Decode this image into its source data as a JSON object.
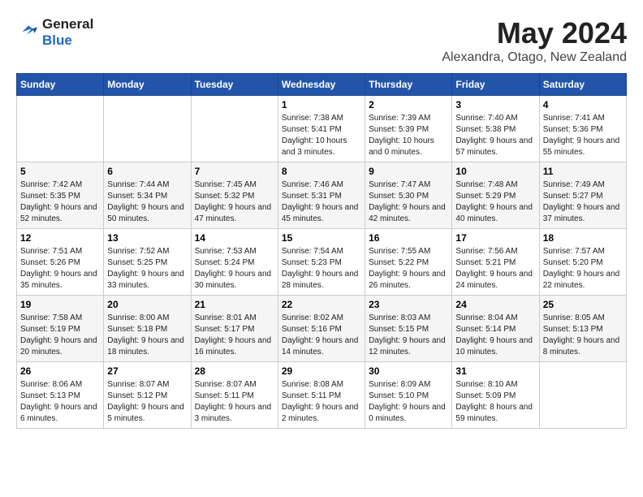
{
  "logo": {
    "line1": "General",
    "line2": "Blue"
  },
  "title": "May 2024",
  "location": "Alexandra, Otago, New Zealand",
  "weekdays": [
    "Sunday",
    "Monday",
    "Tuesday",
    "Wednesday",
    "Thursday",
    "Friday",
    "Saturday"
  ],
  "weeks": [
    [
      {
        "day": "",
        "sunrise": "",
        "sunset": "",
        "daylight": ""
      },
      {
        "day": "",
        "sunrise": "",
        "sunset": "",
        "daylight": ""
      },
      {
        "day": "",
        "sunrise": "",
        "sunset": "",
        "daylight": ""
      },
      {
        "day": "1",
        "sunrise": "Sunrise: 7:38 AM",
        "sunset": "Sunset: 5:41 PM",
        "daylight": "Daylight: 10 hours and 3 minutes."
      },
      {
        "day": "2",
        "sunrise": "Sunrise: 7:39 AM",
        "sunset": "Sunset: 5:39 PM",
        "daylight": "Daylight: 10 hours and 0 minutes."
      },
      {
        "day": "3",
        "sunrise": "Sunrise: 7:40 AM",
        "sunset": "Sunset: 5:38 PM",
        "daylight": "Daylight: 9 hours and 57 minutes."
      },
      {
        "day": "4",
        "sunrise": "Sunrise: 7:41 AM",
        "sunset": "Sunset: 5:36 PM",
        "daylight": "Daylight: 9 hours and 55 minutes."
      }
    ],
    [
      {
        "day": "5",
        "sunrise": "Sunrise: 7:42 AM",
        "sunset": "Sunset: 5:35 PM",
        "daylight": "Daylight: 9 hours and 52 minutes."
      },
      {
        "day": "6",
        "sunrise": "Sunrise: 7:44 AM",
        "sunset": "Sunset: 5:34 PM",
        "daylight": "Daylight: 9 hours and 50 minutes."
      },
      {
        "day": "7",
        "sunrise": "Sunrise: 7:45 AM",
        "sunset": "Sunset: 5:32 PM",
        "daylight": "Daylight: 9 hours and 47 minutes."
      },
      {
        "day": "8",
        "sunrise": "Sunrise: 7:46 AM",
        "sunset": "Sunset: 5:31 PM",
        "daylight": "Daylight: 9 hours and 45 minutes."
      },
      {
        "day": "9",
        "sunrise": "Sunrise: 7:47 AM",
        "sunset": "Sunset: 5:30 PM",
        "daylight": "Daylight: 9 hours and 42 minutes."
      },
      {
        "day": "10",
        "sunrise": "Sunrise: 7:48 AM",
        "sunset": "Sunset: 5:29 PM",
        "daylight": "Daylight: 9 hours and 40 minutes."
      },
      {
        "day": "11",
        "sunrise": "Sunrise: 7:49 AM",
        "sunset": "Sunset: 5:27 PM",
        "daylight": "Daylight: 9 hours and 37 minutes."
      }
    ],
    [
      {
        "day": "12",
        "sunrise": "Sunrise: 7:51 AM",
        "sunset": "Sunset: 5:26 PM",
        "daylight": "Daylight: 9 hours and 35 minutes."
      },
      {
        "day": "13",
        "sunrise": "Sunrise: 7:52 AM",
        "sunset": "Sunset: 5:25 PM",
        "daylight": "Daylight: 9 hours and 33 minutes."
      },
      {
        "day": "14",
        "sunrise": "Sunrise: 7:53 AM",
        "sunset": "Sunset: 5:24 PM",
        "daylight": "Daylight: 9 hours and 30 minutes."
      },
      {
        "day": "15",
        "sunrise": "Sunrise: 7:54 AM",
        "sunset": "Sunset: 5:23 PM",
        "daylight": "Daylight: 9 hours and 28 minutes."
      },
      {
        "day": "16",
        "sunrise": "Sunrise: 7:55 AM",
        "sunset": "Sunset: 5:22 PM",
        "daylight": "Daylight: 9 hours and 26 minutes."
      },
      {
        "day": "17",
        "sunrise": "Sunrise: 7:56 AM",
        "sunset": "Sunset: 5:21 PM",
        "daylight": "Daylight: 9 hours and 24 minutes."
      },
      {
        "day": "18",
        "sunrise": "Sunrise: 7:57 AM",
        "sunset": "Sunset: 5:20 PM",
        "daylight": "Daylight: 9 hours and 22 minutes."
      }
    ],
    [
      {
        "day": "19",
        "sunrise": "Sunrise: 7:58 AM",
        "sunset": "Sunset: 5:19 PM",
        "daylight": "Daylight: 9 hours and 20 minutes."
      },
      {
        "day": "20",
        "sunrise": "Sunrise: 8:00 AM",
        "sunset": "Sunset: 5:18 PM",
        "daylight": "Daylight: 9 hours and 18 minutes."
      },
      {
        "day": "21",
        "sunrise": "Sunrise: 8:01 AM",
        "sunset": "Sunset: 5:17 PM",
        "daylight": "Daylight: 9 hours and 16 minutes."
      },
      {
        "day": "22",
        "sunrise": "Sunrise: 8:02 AM",
        "sunset": "Sunset: 5:16 PM",
        "daylight": "Daylight: 9 hours and 14 minutes."
      },
      {
        "day": "23",
        "sunrise": "Sunrise: 8:03 AM",
        "sunset": "Sunset: 5:15 PM",
        "daylight": "Daylight: 9 hours and 12 minutes."
      },
      {
        "day": "24",
        "sunrise": "Sunrise: 8:04 AM",
        "sunset": "Sunset: 5:14 PM",
        "daylight": "Daylight: 9 hours and 10 minutes."
      },
      {
        "day": "25",
        "sunrise": "Sunrise: 8:05 AM",
        "sunset": "Sunset: 5:13 PM",
        "daylight": "Daylight: 9 hours and 8 minutes."
      }
    ],
    [
      {
        "day": "26",
        "sunrise": "Sunrise: 8:06 AM",
        "sunset": "Sunset: 5:13 PM",
        "daylight": "Daylight: 9 hours and 6 minutes."
      },
      {
        "day": "27",
        "sunrise": "Sunrise: 8:07 AM",
        "sunset": "Sunset: 5:12 PM",
        "daylight": "Daylight: 9 hours and 5 minutes."
      },
      {
        "day": "28",
        "sunrise": "Sunrise: 8:07 AM",
        "sunset": "Sunset: 5:11 PM",
        "daylight": "Daylight: 9 hours and 3 minutes."
      },
      {
        "day": "29",
        "sunrise": "Sunrise: 8:08 AM",
        "sunset": "Sunset: 5:11 PM",
        "daylight": "Daylight: 9 hours and 2 minutes."
      },
      {
        "day": "30",
        "sunrise": "Sunrise: 8:09 AM",
        "sunset": "Sunset: 5:10 PM",
        "daylight": "Daylight: 9 hours and 0 minutes."
      },
      {
        "day": "31",
        "sunrise": "Sunrise: 8:10 AM",
        "sunset": "Sunset: 5:09 PM",
        "daylight": "Daylight: 8 hours and 59 minutes."
      },
      {
        "day": "",
        "sunrise": "",
        "sunset": "",
        "daylight": ""
      }
    ]
  ]
}
